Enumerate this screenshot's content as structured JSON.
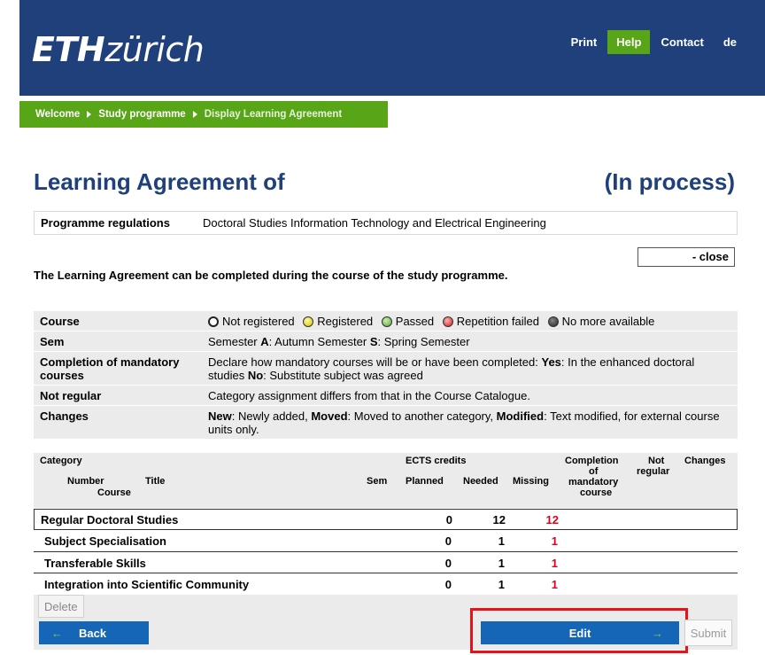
{
  "header": {
    "logo_bold": "ETH",
    "logo_light": "zürich",
    "nav": [
      {
        "label": "Print",
        "active": false
      },
      {
        "label": "Help",
        "active": true
      },
      {
        "label": "Contact",
        "active": false
      },
      {
        "label": "de",
        "active": false
      }
    ]
  },
  "breadcrumb": [
    "Welcome",
    "Study programme",
    "Display Learning Agreement"
  ],
  "page": {
    "title": "Learning Agreement of",
    "status": "(In process)",
    "regulations_label": "Programme regulations",
    "regulations_value": "Doctoral Studies Information Technology and Electrical Engineering",
    "close_label": "- close",
    "intro": "The Learning Agreement can be completed during the course of the study programme."
  },
  "legend": {
    "course_label": "Course",
    "course_items": [
      {
        "icon": "circle-empty-icon",
        "text": "Not registered"
      },
      {
        "icon": "circle-yellow-icon",
        "text": "Registered"
      },
      {
        "icon": "circle-green-icon",
        "text": "Passed"
      },
      {
        "icon": "circle-red-icon",
        "text": "Repetition failed"
      },
      {
        "icon": "circle-dark-icon",
        "text": "No more available"
      }
    ],
    "sem_label": "Sem",
    "sem_text": {
      "a_key": "A",
      "a_val": ": Autumn Semester ",
      "s_key": "S",
      "s_val": ": Spring Semester",
      "prefix": "Semester "
    },
    "completion_label": "Completion of mandatory courses",
    "completion_text": {
      "prefix": "Declare how mandatory courses will be or have been completed: ",
      "yes_key": "Yes",
      "yes_val": ": In the enhanced doctoral studies ",
      "no_key": "No",
      "no_val": ": Substitute subject was agreed"
    },
    "notregular_label": "Not regular",
    "notregular_text": "Category assignment differs from that in the Course Catalogue.",
    "changes_label": "Changes",
    "changes_text": {
      "new_key": "New",
      "new_val": ": Newly added, ",
      "moved_key": "Moved",
      "moved_val": ": Moved to another category, ",
      "mod_key": "Modified",
      "mod_val": ": Text modified, for external course units only."
    }
  },
  "table": {
    "headers": {
      "category": "Category",
      "number": "Number",
      "title": "Title",
      "course": "Course",
      "sem": "Sem",
      "ects": "ECTS credits",
      "planned": "Planned",
      "needed": "Needed",
      "missing": "Missing",
      "completion1": "Completion",
      "completion2": "of",
      "completion3": "mandatory",
      "completion4": "course",
      "notregular1": "Not",
      "notregular2": "regular",
      "changes": "Changes"
    },
    "rows": [
      {
        "name": "Regular Doctoral Studies",
        "planned": "0",
        "needed": "12",
        "missing": "12"
      },
      {
        "name": "Subject Specialisation",
        "planned": "0",
        "needed": "1",
        "missing": "1"
      },
      {
        "name": "Transferable Skills",
        "planned": "0",
        "needed": "1",
        "missing": "1"
      },
      {
        "name": "Integration into Scientific Community",
        "planned": "0",
        "needed": "1",
        "missing": "1"
      }
    ]
  },
  "footer": {
    "delete_label": "Delete",
    "back_label": "Back",
    "edit_label": "Edit",
    "submit_label": "Submit"
  },
  "colors": {
    "brand_blue": "#1f407a",
    "accent_green": "#58a517",
    "button_blue": "#1666b8",
    "missing_red": "#e0001b",
    "highlight_red": "#e8121b"
  }
}
